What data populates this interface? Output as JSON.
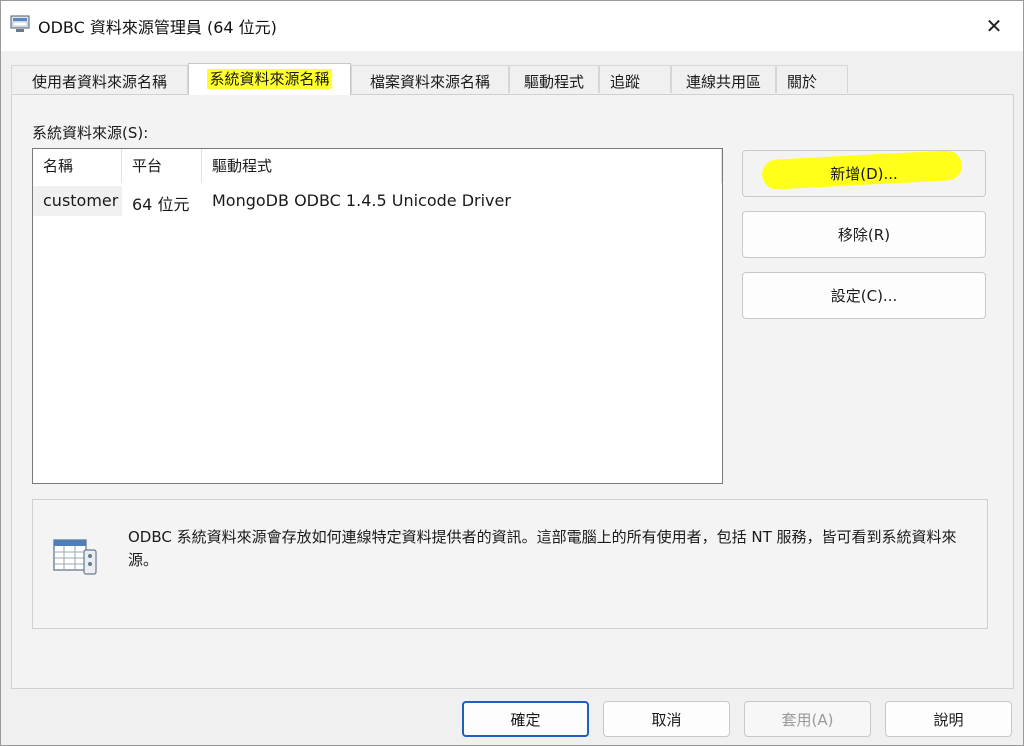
{
  "window": {
    "title": "ODBC 資料來源管理員 (64 位元)",
    "close_glyph": "✕"
  },
  "tabs": [
    {
      "label": "使用者資料來源名稱"
    },
    {
      "label": "系統資料來源名稱"
    },
    {
      "label": "檔案資料來源名稱"
    },
    {
      "label": "驅動程式"
    },
    {
      "label": "追蹤"
    },
    {
      "label": "連線共用區"
    },
    {
      "label": "關於"
    }
  ],
  "main": {
    "group_label": "系統資料來源(S):",
    "columns": [
      "名稱",
      "平台",
      "驅動程式"
    ],
    "rows": [
      {
        "name": "customer",
        "platform": "64 位元",
        "driver": "MongoDB ODBC 1.4.5 Unicode Driver"
      }
    ],
    "buttons": {
      "add": "新增(D)...",
      "remove": "移除(R)",
      "configure": "設定(C)..."
    },
    "info_text": "ODBC 系統資料來源會存放如何連線特定資料提供者的資訊。這部電腦上的所有使用者，包括 NT 服務，皆可看到系統資料來源。"
  },
  "footer": {
    "ok": "確定",
    "cancel": "取消",
    "apply": "套用(A)",
    "help": "說明"
  },
  "colors": {
    "highlight": "#ffff2e",
    "primary_border": "#1f5fbf"
  }
}
